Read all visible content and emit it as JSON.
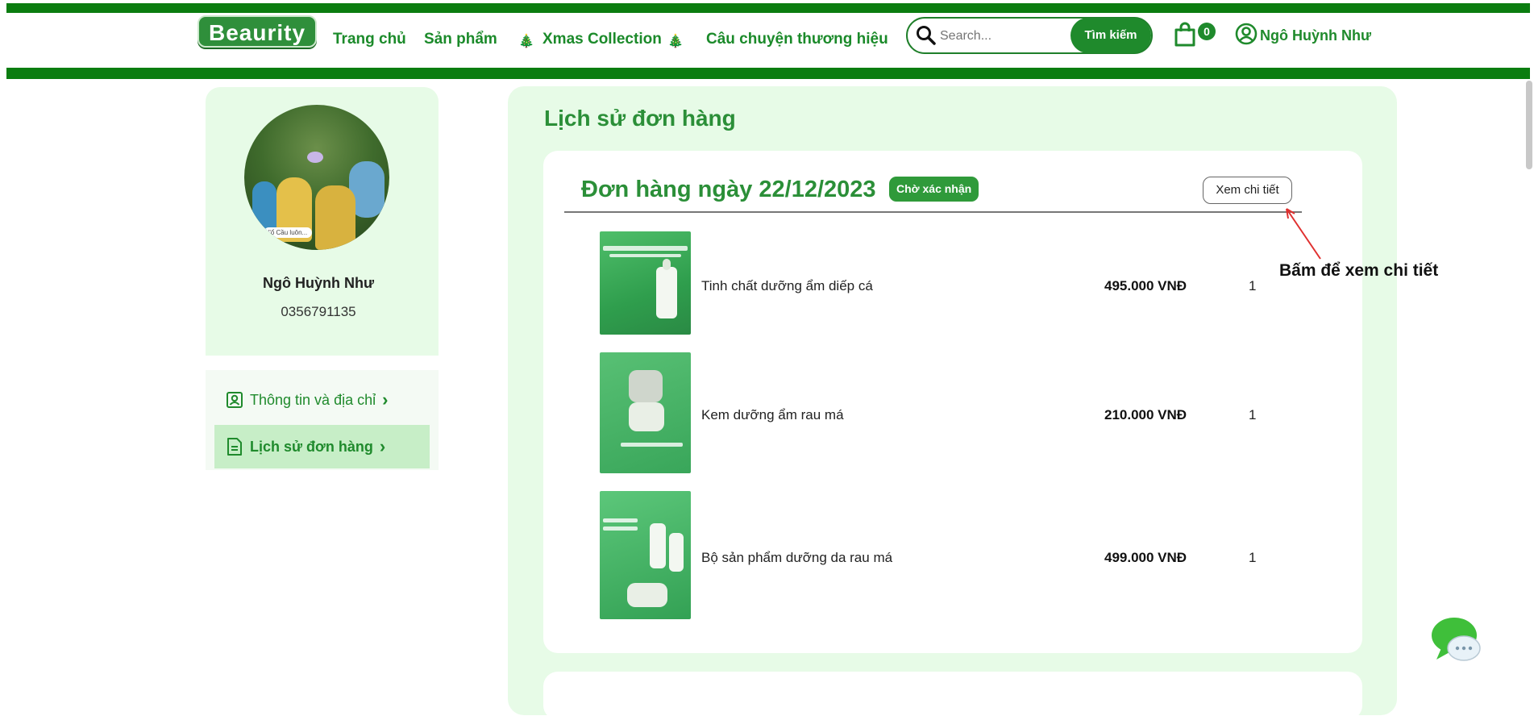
{
  "header": {
    "logo_text": "Beaurity",
    "nav": [
      {
        "label": "Trang chủ"
      },
      {
        "label": "Sản phẩm"
      },
      {
        "label": "Xmas Collection"
      },
      {
        "label": "Câu chuyện thương hiệu"
      }
    ],
    "search_placeholder": "Search...",
    "search_button": "Tìm kiếm",
    "cart_count": "0",
    "user_name": "Ngô Huỳnh Như",
    "tree_glyph": "🎄"
  },
  "profile": {
    "name": "Ngô Huỳnh Như",
    "phone": "0356791135",
    "avatar_tag": "\"ổ Cầu luôn..."
  },
  "sidebar": {
    "items": [
      {
        "label": "Thông tin và địa chỉ",
        "chevron": "›"
      },
      {
        "label": "Lịch sử đơn hàng",
        "chevron": "›"
      }
    ]
  },
  "main": {
    "title": "Lịch sử đơn hàng",
    "order": {
      "title": "Đơn hàng ngày 22/12/2023",
      "status": "Chờ xác nhận",
      "detail_button": "Xem chi tiết",
      "items": [
        {
          "name": "Tinh chất dưỡng ẩm diếp cá",
          "price": "495.000 VNĐ",
          "qty": "1"
        },
        {
          "name": "Kem dưỡng ẩm rau má",
          "price": "210.000 VNĐ",
          "qty": "1"
        },
        {
          "name": "Bộ sản phẩm dưỡng da rau má",
          "price": "499.000 VNĐ",
          "qty": "1"
        }
      ]
    }
  },
  "annotation": {
    "text": "Bấm để xem chi tiết"
  },
  "colors": {
    "brand_green": "#0b7d10",
    "accent_green": "#2b8f38",
    "panel_bg": "#e7fbe7",
    "annotation_arrow": "#e0302f"
  }
}
